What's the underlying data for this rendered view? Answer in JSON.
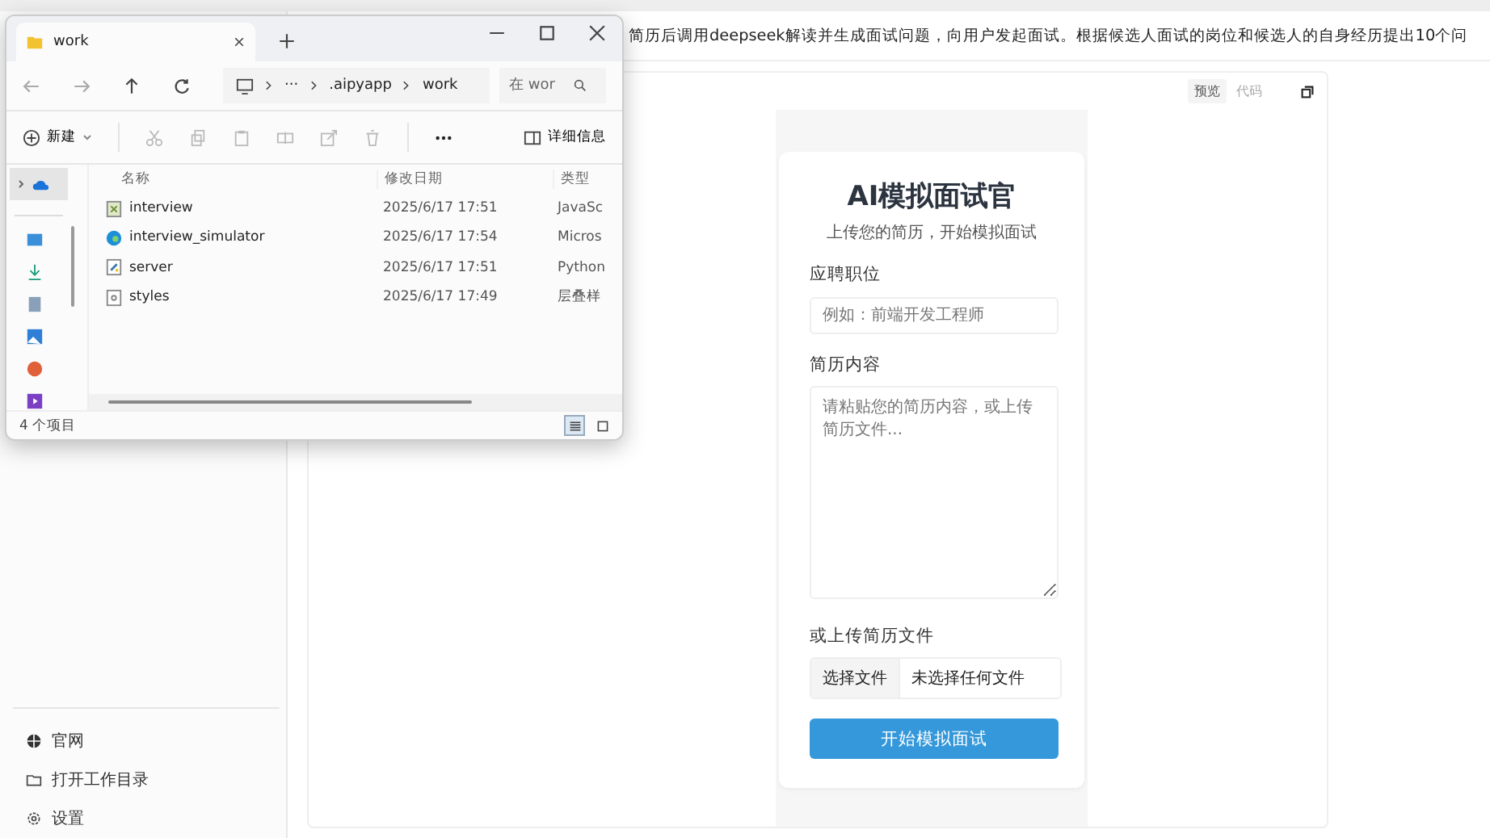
{
  "explorer": {
    "tab": "work",
    "path": [
      "···",
      ".aipyapp",
      "work"
    ],
    "search": {
      "placeholder": "在 wor"
    },
    "new_button": "新建",
    "details_button": "详细信息",
    "columns": [
      "名称",
      "修改日期",
      "类型"
    ],
    "files": [
      {
        "name": "interview",
        "date": "2025/6/17 17:51",
        "type": "JavaSc",
        "kind": "script"
      },
      {
        "name": "interview_simulator",
        "date": "2025/6/17 17:54",
        "type": "Micros",
        "kind": "browser"
      },
      {
        "name": "server",
        "date": "2025/6/17 17:51",
        "type": "Python",
        "kind": "python"
      },
      {
        "name": "styles",
        "date": "2025/6/17 17:49",
        "type": "层叠样",
        "kind": "stylesheet"
      }
    ],
    "status": "4 个项目",
    "view_modes": [
      {
        "kind": "details",
        "selected": true
      },
      {
        "kind": "tiles",
        "selected": false
      }
    ]
  },
  "message": "简历后调用deepseek解读并生成面试问题，向用户发起面试。根据候选人面试的岗位和候选人的自身经历提出10个问",
  "preview": {
    "tabs": [
      {
        "label": "预览",
        "selected": true
      },
      {
        "label": "代码",
        "selected": false
      }
    ]
  },
  "form": {
    "title": "AI模拟面试官",
    "subtitle": "上传您的简历，开始模拟面试",
    "fields": [
      {
        "label": "应聘职位",
        "kind": "input",
        "placeholder": "例如：前端开发工程师"
      },
      {
        "label": "简历内容",
        "kind": "textarea",
        "placeholder": "请粘贴您的简历内容，或上传简历文件..."
      },
      {
        "label": "或上传简历文件",
        "kind": "file",
        "button": "选择文件",
        "value": "未选择任何文件"
      }
    ],
    "submit": "开始模拟面试"
  },
  "sidebar": {
    "items": [
      {
        "label": "官网",
        "kind": "globe"
      },
      {
        "label": "打开工作目录",
        "kind": "folder"
      },
      {
        "label": "设置",
        "kind": "gear"
      }
    ]
  }
}
